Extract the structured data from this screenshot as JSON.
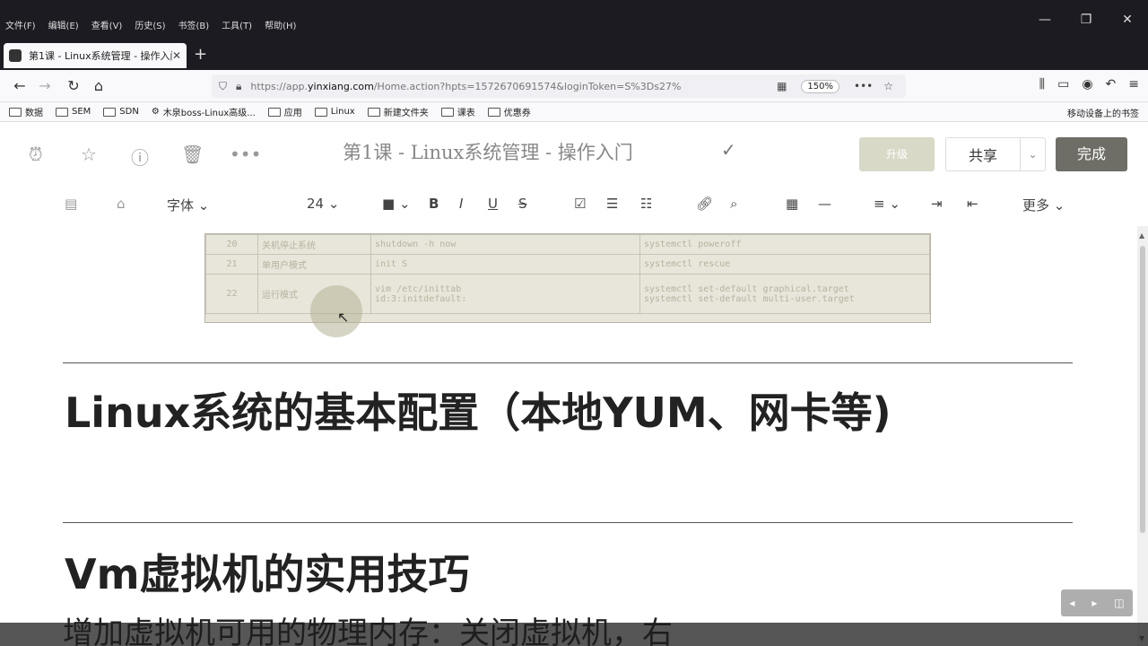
{
  "menubar": {
    "items": [
      "文件(F)",
      "编辑(E)",
      "查看(V)",
      "历史(S)",
      "书签(B)",
      "工具(T)",
      "帮助(H)"
    ]
  },
  "tab": {
    "title": "第1课 - Linux系统管理 - 操作入门"
  },
  "nav": {
    "url_prefix": "https://app.",
    "url_domain": "yinxiang.com",
    "url_rest": "/Home.action?hpts=1572670691574&loginToken=S%3Ds27%",
    "zoom": "150%"
  },
  "bookmarks": {
    "items": [
      "数据",
      "SEM",
      "SDN",
      "木泉boss-Linux高级...",
      "应用",
      "Linux",
      "新建文件夹",
      "课表",
      "优惠券"
    ],
    "mobile": "移动设备上的书签"
  },
  "editor": {
    "doc_title": "第1课 - Linux系统管理 - 操作入门",
    "upgrade_label": "升级",
    "share_label": "共享",
    "done_label": "完成",
    "font_label": "字体",
    "size_label": "24",
    "more_label": "更多"
  },
  "table": {
    "rows": [
      {
        "num": "20",
        "desc": "关机停止系统",
        "old": "shutdown -h now",
        "new": "systemctl poweroff"
      },
      {
        "num": "21",
        "desc": "单用户模式",
        "old": "init S",
        "new": "systemctl rescue"
      },
      {
        "num": "22",
        "desc": "运行模式",
        "old": "vim /etc/inittab",
        "old2": "id:3:initdefault:",
        "new": "systemctl set-default graphical.target",
        "new2": "systemctl set-default multi-user.target"
      }
    ]
  },
  "content": {
    "heading1": "Linux系统的基本配置（本地YUM、网卡等)",
    "heading2": "Vm虚拟机的实用技巧",
    "partial_line": "增加虚拟机可用的物理内存：关闭虚拟机，右"
  }
}
